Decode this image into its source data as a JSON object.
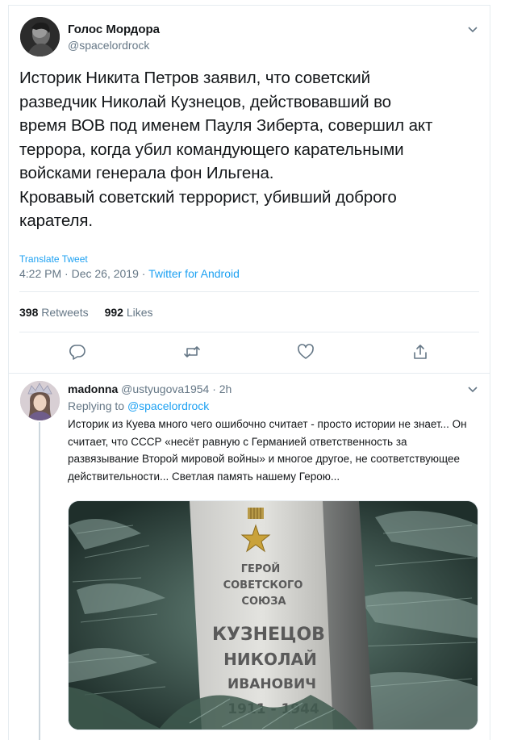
{
  "main_tweet": {
    "display_name": "Голос Мордора",
    "handle": "@spacelordrock",
    "text_lines": [
      "Историк Никита Петров заявил, что советский",
      "разведчик Николай Кузнецов, действовавший во",
      "время ВОВ под именем Пауля Зиберта, совершил акт",
      "террора, когда убил командующего карательными",
      "войсками генерала фон Ильгена.",
      "Кровавый советский террорист, убивший доброго",
      "карателя."
    ],
    "translate_label": "Translate Tweet",
    "timestamp": "4:22 PM · Dec 26, 2019 · ",
    "source": "Twitter for Android",
    "retweets_count": "398",
    "retweets_label": "Retweets",
    "likes_count": "992",
    "likes_label": "Likes",
    "icons": {
      "reply": "reply-icon",
      "retweet": "retweet-icon",
      "like": "heart-icon",
      "share": "share-icon",
      "menu": "chevron-down-icon"
    }
  },
  "reply_tweet": {
    "display_name": "madonna",
    "handle_time": " @ustyugova1954 · 2h",
    "replying_prefix": "Replying to ",
    "replying_to": "@spacelordrock",
    "text": "Историк из Куева много чего ошибочно считает - просто истории не знает... Он считает, что СССР «несёт равную с Германией ответственность за развязывание Второй мировой войны» и многое другое, не соответствующее действительности... Светлая память нашему Герою...",
    "photo_inscription": {
      "line1": "ГЕРОЙ",
      "line2": "СОВЕТСКОГО",
      "line3": "СОЮЗА",
      "surname": "КУЗНЕЦОВ",
      "name": "НИКОЛАЙ",
      "patronymic": "ИВАНОВИЧ",
      "years": "1911 - 1944"
    }
  },
  "colors": {
    "accent": "#1da1f2",
    "muted": "#657786",
    "text": "#14171a",
    "divider": "#e6ecf0"
  }
}
